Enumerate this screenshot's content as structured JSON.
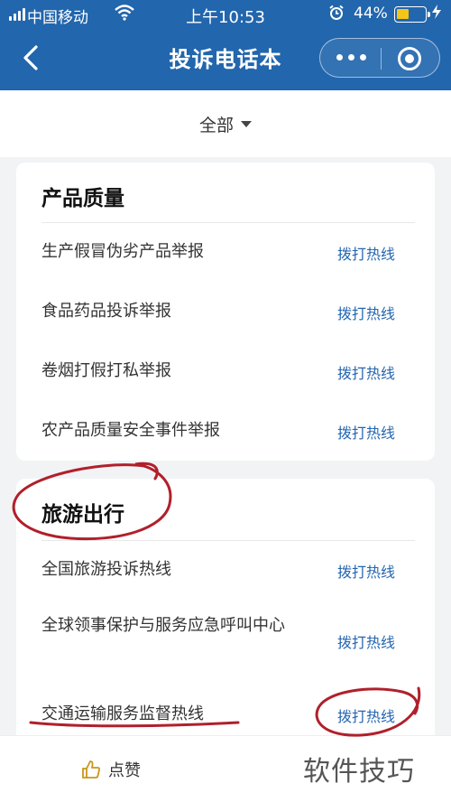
{
  "status_bar": {
    "carrier": "中国移动",
    "time": "上午10:53",
    "battery": "44%",
    "battery_level": 0.44
  },
  "nav": {
    "title": "投诉电话本"
  },
  "filter": {
    "label": "全部"
  },
  "sections": [
    {
      "title": "产品质量",
      "items": [
        {
          "label": "生产假冒伪劣产品举报",
          "action": "拨打热线"
        },
        {
          "label": "食品药品投诉举报",
          "action": "拨打热线"
        },
        {
          "label": "卷烟打假打私举报",
          "action": "拨打热线"
        },
        {
          "label": "农产品质量安全事件举报",
          "action": "拨打热线"
        }
      ]
    },
    {
      "title": "旅游出行",
      "items": [
        {
          "label": "全国旅游投诉热线",
          "action": "拨打热线"
        },
        {
          "label": "全球领事保护与服务应急呼叫中心",
          "action": "拨打热线"
        },
        {
          "label": "交通运输服务监督热线",
          "action": "拨打热线"
        }
      ]
    }
  ],
  "bottom": {
    "like_label": "点赞",
    "watermark": "软件技巧"
  },
  "colors": {
    "header_bg": "#2266ad",
    "link": "#2566b0",
    "annotation": "#b0202b"
  },
  "icons": [
    "signal-icon",
    "wifi-icon",
    "alarm-icon",
    "battery-icon",
    "back-icon",
    "more-icon",
    "target-icon",
    "caret-down-icon",
    "thumbs-up-icon"
  ]
}
